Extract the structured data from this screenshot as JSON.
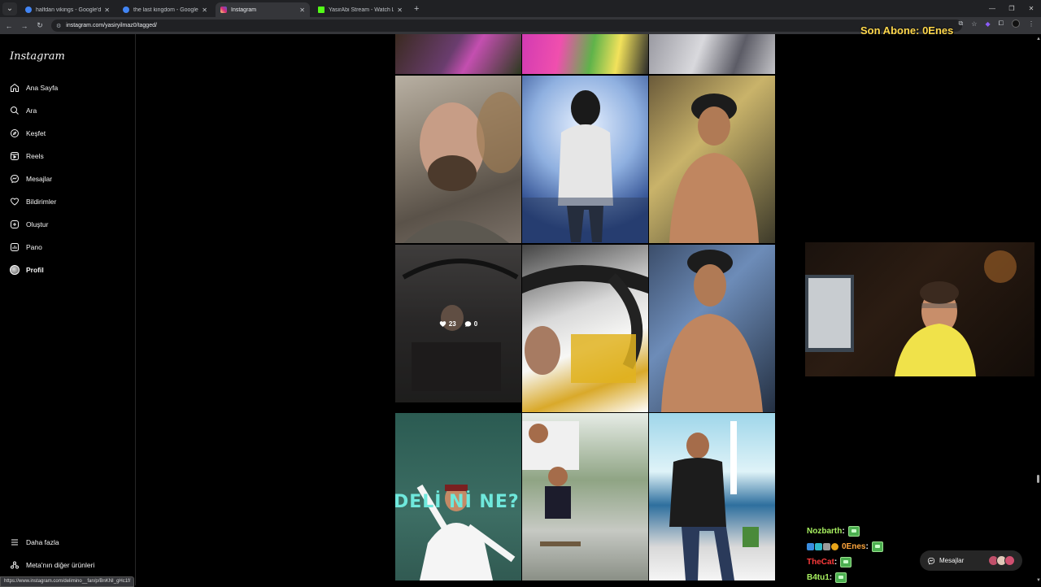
{
  "browser": {
    "tabs": [
      {
        "label": "halfdan vikings - Google'da Ara",
        "favicon_color": "#4285f4"
      },
      {
        "label": "the last kingdom - Google'da Ara",
        "favicon_color": "#4285f4"
      },
      {
        "label": "Instagram",
        "favicon_color": "#e1306c"
      },
      {
        "label": "YasirAbi Stream - Watch Live on",
        "favicon_color": "#53fc18"
      }
    ],
    "url": "instagram.com/yasiryilmaz0/tagged/"
  },
  "overlay": {
    "son_abone": "Son Abone: 0Enes"
  },
  "sidebar": {
    "logo": "Instagram",
    "items": [
      {
        "label": "Ana Sayfa",
        "icon": "home-icon"
      },
      {
        "label": "Ara",
        "icon": "search-icon"
      },
      {
        "label": "Keşfet",
        "icon": "compass-icon"
      },
      {
        "label": "Reels",
        "icon": "reels-icon"
      },
      {
        "label": "Mesajlar",
        "icon": "messenger-icon"
      },
      {
        "label": "Bildirimler",
        "icon": "heart-icon"
      },
      {
        "label": "Oluştur",
        "icon": "plus-square-icon"
      },
      {
        "label": "Pano",
        "icon": "dashboard-icon"
      },
      {
        "label": "Profil",
        "icon": "avatar"
      }
    ],
    "more": {
      "label": "Daha fazla",
      "icon": "menu-icon"
    },
    "meta": {
      "label": "Meta'nın diğer ürünleri",
      "icon": "meta-icon"
    }
  },
  "post_hover": {
    "likes": "23",
    "comments": "0"
  },
  "post_text": {
    "deli_ne": "DELİ Nİ NE?"
  },
  "chat": {
    "messages": [
      {
        "user": "Nozbarth",
        "color": "#a8f060",
        "suffix": " :"
      },
      {
        "user": "0Enes",
        "color": "#ffa63d",
        "suffix": " :"
      },
      {
        "user": "TheCat",
        "color": "#ff3b3b",
        "suffix": " :"
      },
      {
        "user": "B4tu1",
        "color": "#a8f060",
        "suffix": " :"
      }
    ]
  },
  "messages_pill": {
    "label": "Mesajlar"
  },
  "status_url": "https://www.instagram.com/delimino__fan/p/BnKNI_gHc1f/"
}
